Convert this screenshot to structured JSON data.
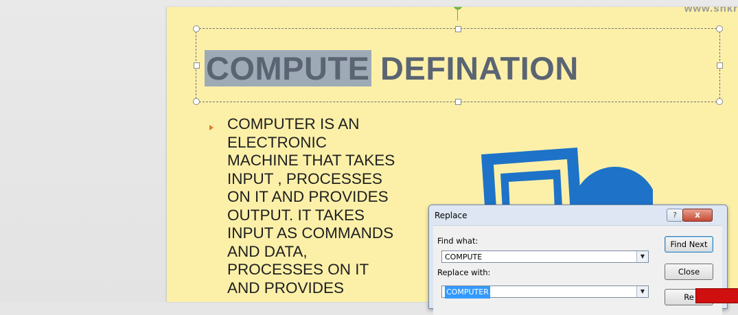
{
  "watermark_url": "www.snkr",
  "slide": {
    "title_highlighted": "COMPUTE",
    "title_rest": " DEFINATION",
    "bullet_text": "COMPUTER  IS AN\nELECTRONIC\nMACHINE  THAT  TAKES\nINPUT  , PROCESSES\nON IT AND  PROVIDES\nOUTPUT.  IT TAKES\nINPUT  AS  COMMANDS\nAND  DATA,\nPROCESSES  ON  IT\nAND  PROVIDES"
  },
  "dialog": {
    "title": "Replace",
    "help": "?",
    "close": "x",
    "find_label": "Find what:",
    "find_value": "COMPUTE",
    "replace_label": "Replace with:",
    "replace_value": "COMPUTER",
    "find_next": "Find Next",
    "close_btn": "Close",
    "replace_btn": "Re"
  },
  "colors": {
    "slide_bg": "#fcf0a9",
    "title_color": "#5a6472",
    "bullet_arrow": "#e07b2f",
    "clip_blue": "#1e73c8"
  }
}
